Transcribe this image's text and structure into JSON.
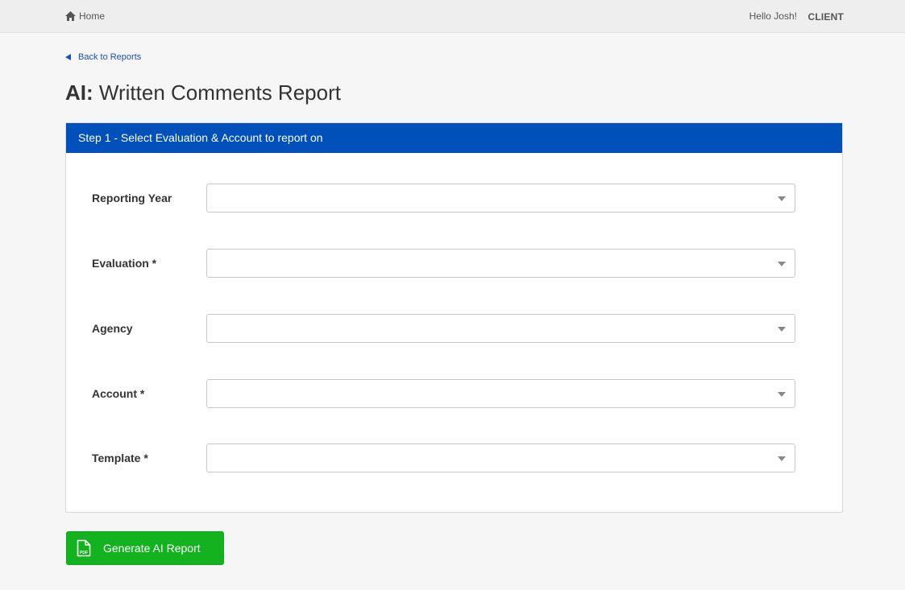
{
  "topbar": {
    "home_label": "Home",
    "greeting": "Hello Josh!",
    "role": "CLIENT"
  },
  "back_link": {
    "label": "Back to Reports"
  },
  "page": {
    "title_prefix": "AI:",
    "title": "Written Comments Report"
  },
  "panel": {
    "header": "Step 1 - Select Evaluation & Account to report on",
    "fields": [
      {
        "label": "Reporting Year",
        "value": ""
      },
      {
        "label": "Evaluation *",
        "value": ""
      },
      {
        "label": "Agency",
        "value": ""
      },
      {
        "label": "Account *",
        "value": ""
      },
      {
        "label": "Template *",
        "value": ""
      }
    ]
  },
  "actions": {
    "generate_label": "Generate AI Report"
  },
  "colors": {
    "header_blue": "#0050bb",
    "button_green": "#12b31f",
    "link_blue": "#1a4fb5"
  }
}
